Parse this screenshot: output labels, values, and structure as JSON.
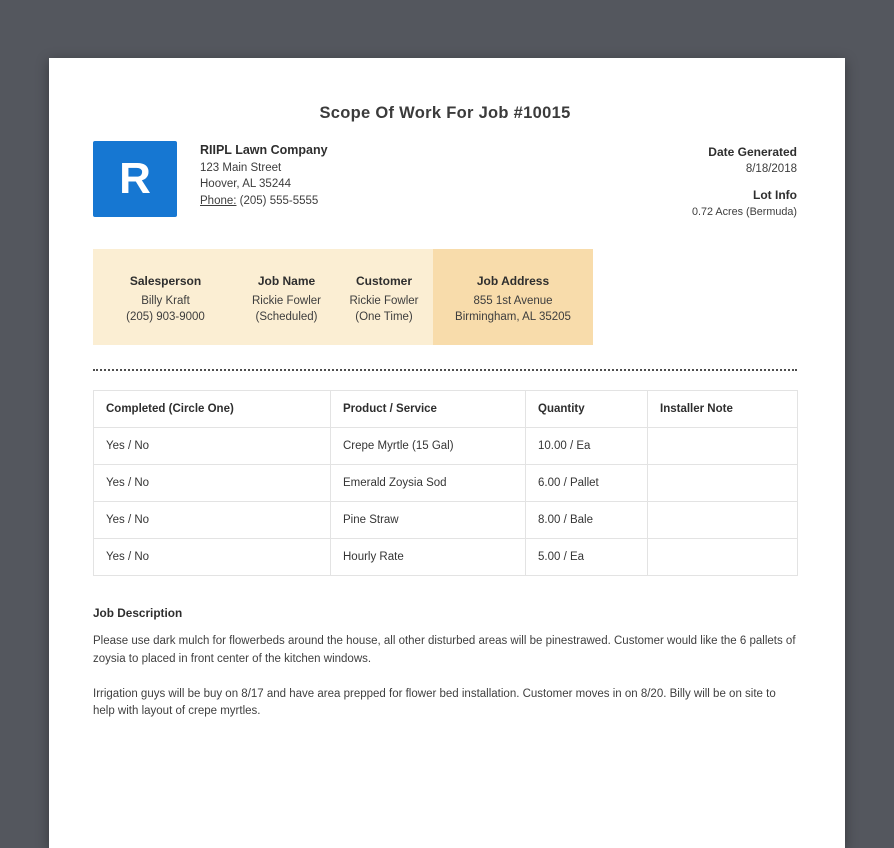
{
  "page": {
    "title": "Scope Of Work For Job #10015"
  },
  "header": {
    "logo_letter": "R",
    "company": {
      "name": "RIIPL Lawn Company",
      "address_line1": "123 Main Street",
      "address_line2": "Hoover, AL 35244",
      "phone_label": "Phone:",
      "phone_value": "(205) 555-5555"
    },
    "meta": {
      "date_generated_label": "Date Generated",
      "date_generated_value": "8/18/2018",
      "lot_info_label": "Lot Info",
      "lot_info_value": "0.72 Acres (Bermuda)"
    }
  },
  "job_summary": {
    "columns": [
      {
        "label": "Salesperson",
        "line1": "Billy Kraft",
        "line2": "(205) 903-9000"
      },
      {
        "label": "Job Name",
        "line1": "Rickie Fowler",
        "line2": "(Scheduled)"
      },
      {
        "label": "Customer",
        "line1": "Rickie Fowler",
        "line2": "(One Time)"
      },
      {
        "label": "Job Address",
        "line1": "855 1st Avenue",
        "line2": "Birmingham, AL 35205"
      }
    ]
  },
  "work_table": {
    "headers": [
      "Completed (Circle One)",
      "Product / Service",
      "Quantity",
      "Installer Note"
    ],
    "rows": [
      [
        "Yes / No",
        "Crepe Myrtle (15 Gal)",
        "10.00 / Ea",
        ""
      ],
      [
        "Yes / No",
        "Emerald Zoysia Sod",
        "6.00 / Pallet",
        ""
      ],
      [
        "Yes / No",
        "Pine Straw",
        "8.00 / Bale",
        ""
      ],
      [
        "Yes / No",
        "Hourly Rate",
        "5.00 / Ea",
        ""
      ]
    ]
  },
  "job_description": {
    "heading": "Job Description",
    "paragraphs": [
      "Please use dark mulch for flowerbeds around the house, all other disturbed areas will be pinestrawed. Customer would like the 6 pallets of zoysia to placed in front center of the kitchen windows.",
      "Irrigation guys will be buy on 8/17 and have area prepped for flower bed installation. Customer moves in on 8/20. Billy will be on site to help with layout of crepe myrtles."
    ]
  },
  "colors": {
    "backdrop": "#54575e",
    "sheet": "#ffffff",
    "logo_blue": "#1677d2",
    "band_light": "#fbeed3",
    "band_highlight": "#f8dcab",
    "text": "#3d3d3d",
    "table_border": "#e3e3e3"
  }
}
